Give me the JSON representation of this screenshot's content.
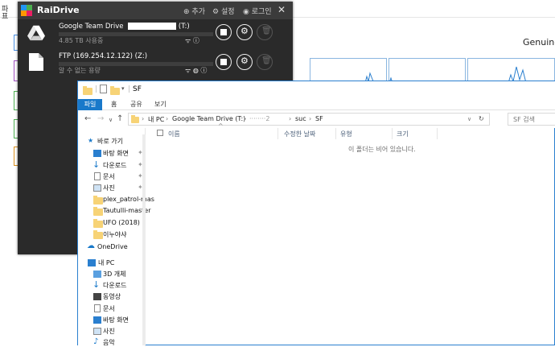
{
  "background_app": {
    "menu": [
      "파",
      "표"
    ],
    "genuine_text": "Genuine"
  },
  "raidrive": {
    "title": "RaiDrive",
    "add_label": "추가",
    "settings_label": "설정",
    "login_label": "로그인",
    "close_label": "✕",
    "drives": [
      {
        "name_prefix": "Google Team Drive",
        "name_suffix": "(T:)",
        "usage": "4.85 TB 사용중",
        "type": "google-drive"
      },
      {
        "name_prefix": "FTP (169.254.12.122) (Z:)",
        "name_suffix": "",
        "usage": "알 수 없는 용량",
        "type": "ftp"
      }
    ]
  },
  "explorer": {
    "title": "SF",
    "ribbon_tabs": [
      "파일",
      "홈",
      "공유",
      "보기"
    ],
    "breadcrumb": [
      "내 PC",
      "Google Team Drive (T:)",
      "········2",
      "suc",
      "SF"
    ],
    "search_placeholder": "SF 검색",
    "nav": {
      "quick_access": "바로 가기",
      "quick_items": [
        "바탕 화면",
        "다운로드",
        "문서",
        "사진",
        "plex_patrol-mas",
        "Tautulli-master",
        "UFO (2018)",
        "이누야샤"
      ],
      "onedrive": "OneDrive",
      "this_pc": "내 PC",
      "pc_items": [
        "3D 개체",
        "다운로드",
        "동영상",
        "문서",
        "바탕 화면",
        "사진",
        "음악"
      ]
    },
    "columns": [
      "이름",
      "수정한 날짜",
      "유형",
      "크기"
    ],
    "empty_message": "이 폴더는 비어 있습니다."
  },
  "colors": {
    "accent": "#1979ca",
    "raidrive_bg": "#2a2a2a",
    "folder": "#f7d376"
  }
}
